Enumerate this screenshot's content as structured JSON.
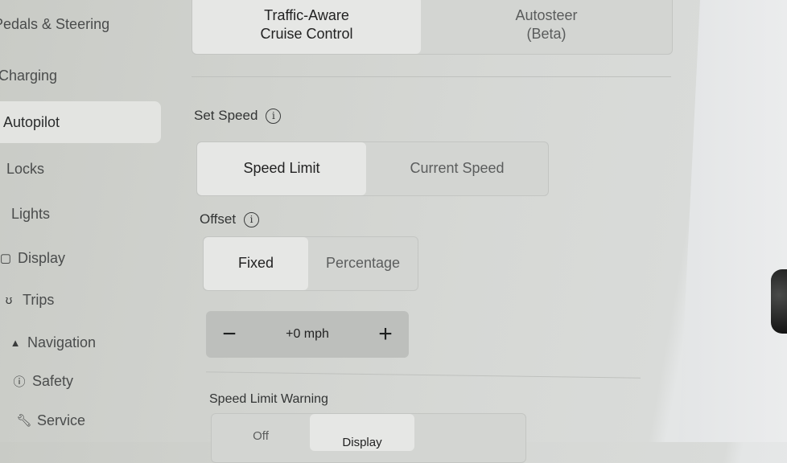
{
  "sidebar": {
    "items": [
      {
        "label": "Pedals & Steering",
        "icon": ""
      },
      {
        "label": "Charging",
        "icon": ""
      },
      {
        "label": "Autopilot",
        "icon": "",
        "active": true
      },
      {
        "label": "Locks",
        "icon": ""
      },
      {
        "label": "Lights",
        "icon": ""
      },
      {
        "label": "Display",
        "icon": "☐"
      },
      {
        "label": "Trips",
        "icon": "ꟸ"
      },
      {
        "label": "Navigation",
        "icon": "▲"
      },
      {
        "label": "Safety",
        "icon": "ⓘ"
      },
      {
        "label": "Service",
        "icon": "🔧"
      }
    ]
  },
  "autopilot_mode": {
    "options": [
      "Traffic-Aware\nCruise Control",
      "Autosteer\n(Beta)"
    ],
    "selected": "Traffic-Aware Cruise Control"
  },
  "set_speed": {
    "label": "Set Speed",
    "info_icon": "i",
    "options": [
      "Speed Limit",
      "Current Speed"
    ],
    "selected": "Speed Limit"
  },
  "offset": {
    "label": "Offset",
    "info_icon": "i",
    "options": [
      "Fixed",
      "Percentage"
    ],
    "selected": "Fixed",
    "stepper": {
      "minus": "−",
      "value": "+0 mph",
      "plus": "+"
    }
  },
  "speed_limit_warning": {
    "label": "Speed Limit Warning",
    "options": [
      "Off",
      "Display",
      ""
    ],
    "selected": "Display"
  }
}
